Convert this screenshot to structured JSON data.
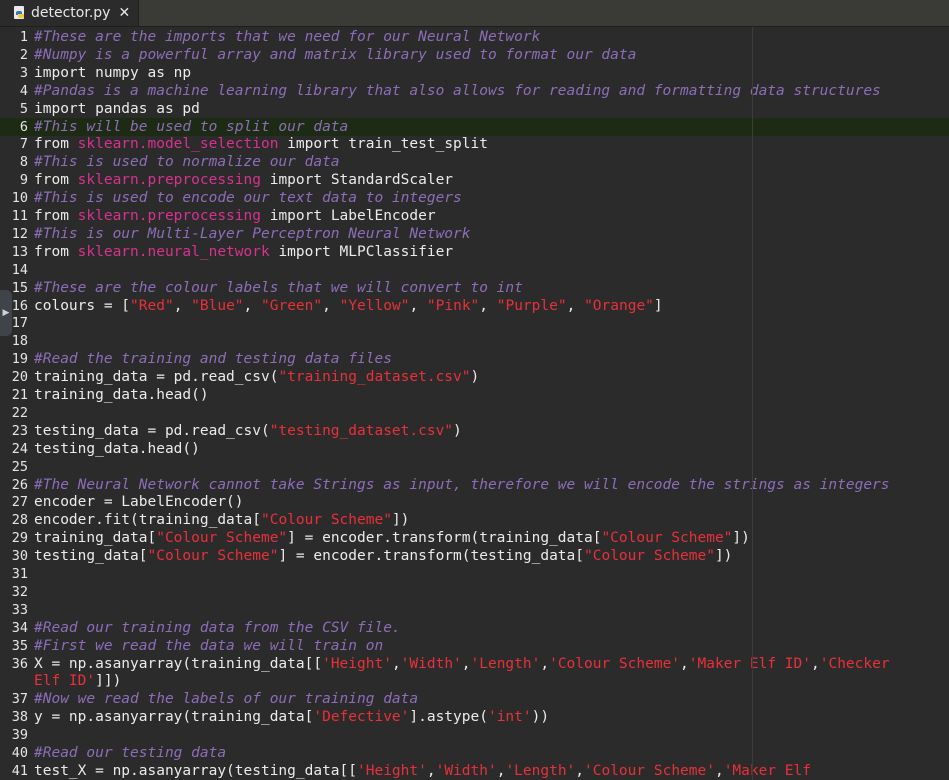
{
  "tab": {
    "title": "detector.py",
    "close": "✕",
    "icon": "python-file-icon"
  },
  "current_line": 6,
  "lines": [
    {
      "n": "1",
      "tokens": [
        {
          "t": "#These are the imports that we need for our Neural Network",
          "k": "comment"
        }
      ]
    },
    {
      "n": "2",
      "tokens": [
        {
          "t": "#Numpy is a powerful array and matrix library used to format our data",
          "k": "comment"
        }
      ]
    },
    {
      "n": "3",
      "tokens": [
        {
          "t": "import numpy as np",
          "k": "plain"
        }
      ]
    },
    {
      "n": "4",
      "tokens": [
        {
          "t": "#Pandas is a machine learning library that also allows for reading and formatting data structures",
          "k": "comment"
        }
      ]
    },
    {
      "n": "5",
      "tokens": [
        {
          "t": "import pandas as pd",
          "k": "plain"
        }
      ]
    },
    {
      "n": "6",
      "tokens": [
        {
          "t": "#This will be used to split our data",
          "k": "comment"
        }
      ]
    },
    {
      "n": "7",
      "tokens": [
        {
          "t": "from ",
          "k": "plain"
        },
        {
          "t": "sklearn.model_selection",
          "k": "module"
        },
        {
          "t": " import train_test_split",
          "k": "plain"
        }
      ]
    },
    {
      "n": "8",
      "tokens": [
        {
          "t": "#This is used to normalize our data",
          "k": "comment"
        }
      ]
    },
    {
      "n": "9",
      "tokens": [
        {
          "t": "from ",
          "k": "plain"
        },
        {
          "t": "sklearn.preprocessing",
          "k": "module"
        },
        {
          "t": " import StandardScaler",
          "k": "plain"
        }
      ]
    },
    {
      "n": "10",
      "tokens": [
        {
          "t": "#This is used to encode our text data to integers",
          "k": "comment"
        }
      ]
    },
    {
      "n": "11",
      "tokens": [
        {
          "t": "from ",
          "k": "plain"
        },
        {
          "t": "sklearn.preprocessing",
          "k": "module"
        },
        {
          "t": " import LabelEncoder",
          "k": "plain"
        }
      ]
    },
    {
      "n": "12",
      "tokens": [
        {
          "t": "#This is our Multi-Layer Perceptron Neural Network",
          "k": "comment"
        }
      ]
    },
    {
      "n": "13",
      "tokens": [
        {
          "t": "from ",
          "k": "plain"
        },
        {
          "t": "sklearn.neural_network",
          "k": "module"
        },
        {
          "t": " import MLPClassifier",
          "k": "plain"
        }
      ]
    },
    {
      "n": "14",
      "tokens": []
    },
    {
      "n": "15",
      "tokens": [
        {
          "t": "#These are the colour labels that we will convert to int",
          "k": "comment"
        }
      ]
    },
    {
      "n": "16",
      "tokens": [
        {
          "t": "colours = [",
          "k": "plain"
        },
        {
          "t": "\"Red\"",
          "k": "string"
        },
        {
          "t": ", ",
          "k": "plain"
        },
        {
          "t": "\"Blue\"",
          "k": "string"
        },
        {
          "t": ", ",
          "k": "plain"
        },
        {
          "t": "\"Green\"",
          "k": "string"
        },
        {
          "t": ", ",
          "k": "plain"
        },
        {
          "t": "\"Yellow\"",
          "k": "string"
        },
        {
          "t": ", ",
          "k": "plain"
        },
        {
          "t": "\"Pink\"",
          "k": "string"
        },
        {
          "t": ", ",
          "k": "plain"
        },
        {
          "t": "\"Purple\"",
          "k": "string"
        },
        {
          "t": ", ",
          "k": "plain"
        },
        {
          "t": "\"Orange\"",
          "k": "string"
        },
        {
          "t": "]",
          "k": "plain"
        }
      ]
    },
    {
      "n": "17",
      "tokens": []
    },
    {
      "n": "18",
      "tokens": []
    },
    {
      "n": "19",
      "tokens": [
        {
          "t": "#Read the training and testing data files",
          "k": "comment"
        }
      ]
    },
    {
      "n": "20",
      "tokens": [
        {
          "t": "training_data = pd.read_csv(",
          "k": "plain"
        },
        {
          "t": "\"training_dataset.csv\"",
          "k": "string"
        },
        {
          "t": ")",
          "k": "plain"
        }
      ]
    },
    {
      "n": "21",
      "tokens": [
        {
          "t": "training_data.head()",
          "k": "plain"
        }
      ]
    },
    {
      "n": "22",
      "tokens": []
    },
    {
      "n": "23",
      "tokens": [
        {
          "t": "testing_data = pd.read_csv(",
          "k": "plain"
        },
        {
          "t": "\"testing_dataset.csv\"",
          "k": "string"
        },
        {
          "t": ")",
          "k": "plain"
        }
      ]
    },
    {
      "n": "24",
      "tokens": [
        {
          "t": "testing_data.head()",
          "k": "plain"
        }
      ]
    },
    {
      "n": "25",
      "tokens": []
    },
    {
      "n": "26",
      "tokens": [
        {
          "t": "#The Neural Network cannot take Strings as input, therefore we will encode the strings as integers",
          "k": "comment"
        }
      ]
    },
    {
      "n": "27",
      "tokens": [
        {
          "t": "encoder = LabelEncoder()",
          "k": "plain"
        }
      ]
    },
    {
      "n": "28",
      "tokens": [
        {
          "t": "encoder.fit(training_data[",
          "k": "plain"
        },
        {
          "t": "\"Colour Scheme\"",
          "k": "string"
        },
        {
          "t": "])",
          "k": "plain"
        }
      ]
    },
    {
      "n": "29",
      "tokens": [
        {
          "t": "training_data[",
          "k": "plain"
        },
        {
          "t": "\"Colour Scheme\"",
          "k": "string"
        },
        {
          "t": "] = encoder.transform(training_data[",
          "k": "plain"
        },
        {
          "t": "\"Colour Scheme\"",
          "k": "string"
        },
        {
          "t": "])",
          "k": "plain"
        }
      ]
    },
    {
      "n": "30",
      "tokens": [
        {
          "t": "testing_data[",
          "k": "plain"
        },
        {
          "t": "\"Colour Scheme\"",
          "k": "string"
        },
        {
          "t": "] = encoder.transform(testing_data[",
          "k": "plain"
        },
        {
          "t": "\"Colour Scheme\"",
          "k": "string"
        },
        {
          "t": "])",
          "k": "plain"
        }
      ]
    },
    {
      "n": "31",
      "tokens": []
    },
    {
      "n": "32",
      "tokens": []
    },
    {
      "n": "33",
      "tokens": []
    },
    {
      "n": "34",
      "tokens": [
        {
          "t": "#Read our training data from the CSV file.",
          "k": "comment"
        }
      ]
    },
    {
      "n": "35",
      "tokens": [
        {
          "t": "#First we read the data we will train on",
          "k": "comment"
        }
      ]
    },
    {
      "n": "36",
      "tokens": [
        {
          "t": "X = np.asanyarray(training_data[[",
          "k": "plain"
        },
        {
          "t": "'Height'",
          "k": "string"
        },
        {
          "t": ",",
          "k": "plain"
        },
        {
          "t": "'Width'",
          "k": "string"
        },
        {
          "t": ",",
          "k": "plain"
        },
        {
          "t": "'Length'",
          "k": "string"
        },
        {
          "t": ",",
          "k": "plain"
        },
        {
          "t": "'Colour Scheme'",
          "k": "string"
        },
        {
          "t": ",",
          "k": "plain"
        },
        {
          "t": "'Maker Elf ID'",
          "k": "string"
        },
        {
          "t": ",",
          "k": "plain"
        },
        {
          "t": "'Checker",
          "k": "string"
        }
      ]
    },
    {
      "n": "",
      "tokens": [
        {
          "t": "Elf ID'",
          "k": "string"
        },
        {
          "t": "]])",
          "k": "plain"
        }
      ]
    },
    {
      "n": "37",
      "tokens": [
        {
          "t": "#Now we read the labels of our training data",
          "k": "comment"
        }
      ]
    },
    {
      "n": "38",
      "tokens": [
        {
          "t": "y = np.asanyarray(training_data[",
          "k": "plain"
        },
        {
          "t": "'Defective'",
          "k": "string"
        },
        {
          "t": "].astype(",
          "k": "plain"
        },
        {
          "t": "'int'",
          "k": "string"
        },
        {
          "t": "))",
          "k": "plain"
        }
      ]
    },
    {
      "n": "39",
      "tokens": []
    },
    {
      "n": "40",
      "tokens": [
        {
          "t": "#Read our testing data",
          "k": "comment"
        }
      ]
    },
    {
      "n": "41",
      "tokens": [
        {
          "t": "test_X = np.asanyarray(testing_data[[",
          "k": "plain"
        },
        {
          "t": "'Height'",
          "k": "string"
        },
        {
          "t": ",",
          "k": "plain"
        },
        {
          "t": "'Width'",
          "k": "string"
        },
        {
          "t": ",",
          "k": "plain"
        },
        {
          "t": "'Length'",
          "k": "string"
        },
        {
          "t": ",",
          "k": "plain"
        },
        {
          "t": "'Colour Scheme'",
          "k": "string"
        },
        {
          "t": ",",
          "k": "plain"
        },
        {
          "t": "'Maker Elf",
          "k": "string"
        }
      ]
    }
  ],
  "colors": {
    "background": "#2b2b2b",
    "comment": "#8d6db8",
    "module": "#d6328e",
    "string": "#e8303a",
    "text": "#ebebeb",
    "current_line": "#1d2a14"
  },
  "side_handle": {
    "icon": "expand-arrow-icon",
    "glyph": "▶"
  }
}
